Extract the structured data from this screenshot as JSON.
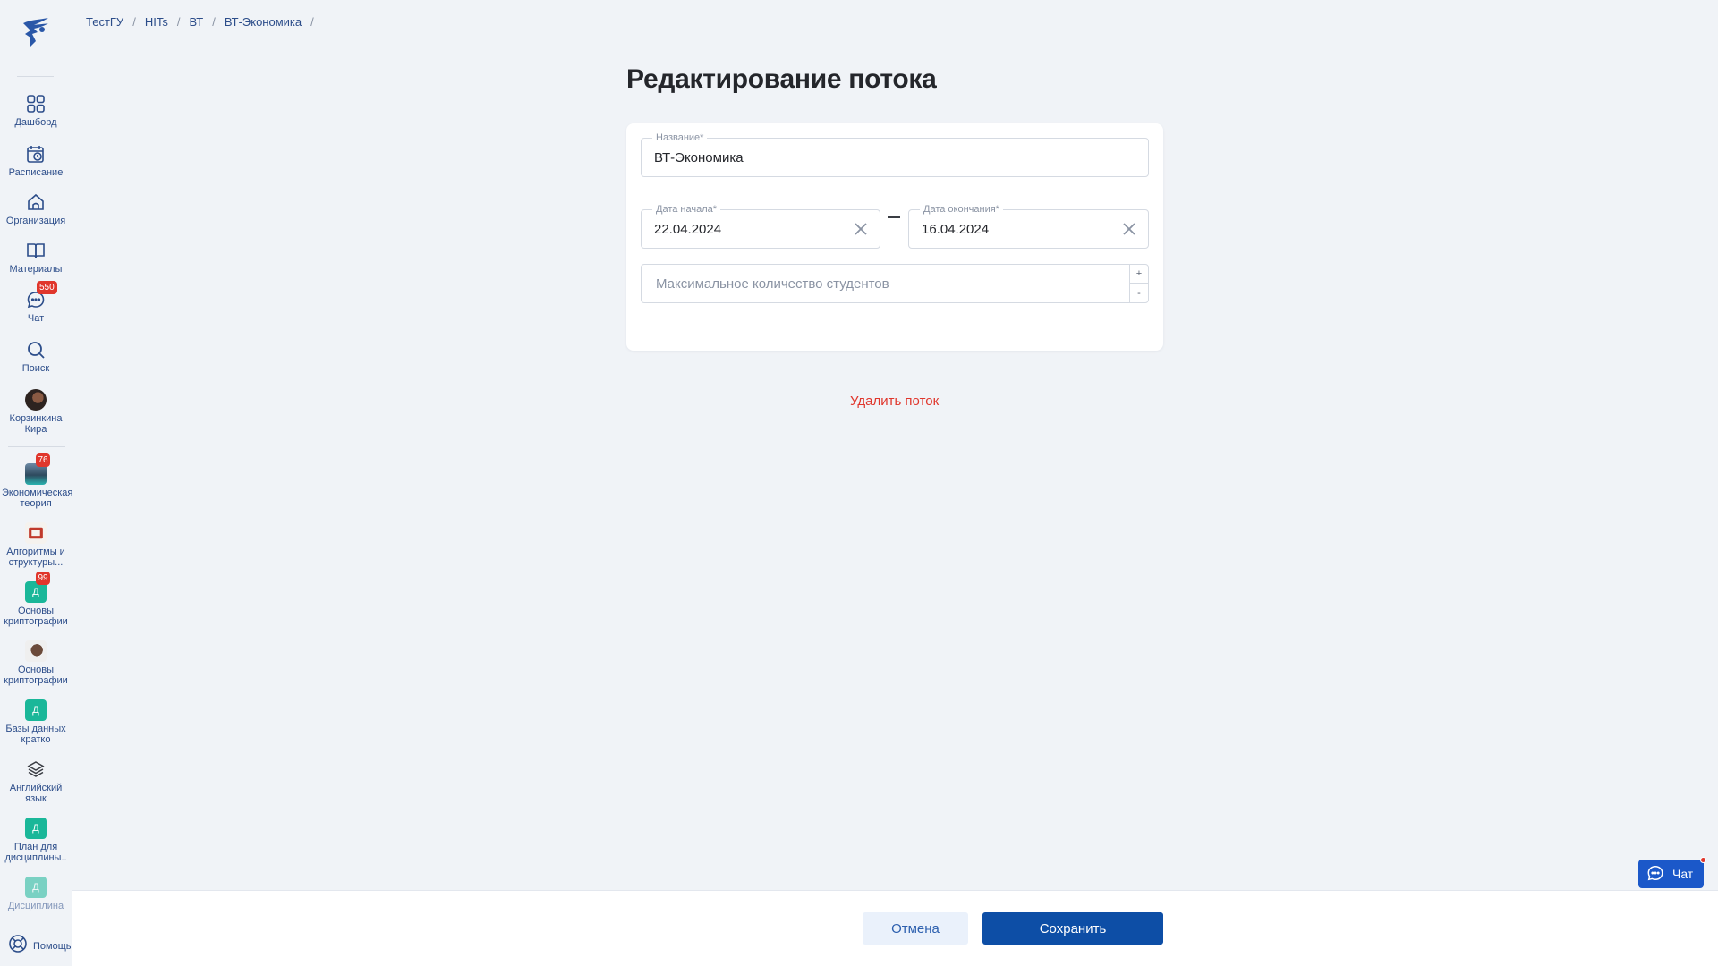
{
  "breadcrumbs": [
    "ТестГУ",
    "HITs",
    "ВТ",
    "ВТ-Экономика"
  ],
  "breadcrumb_separator": "/",
  "sidebar": {
    "nav": [
      {
        "label": "Дашборд",
        "icon": "dashboard-icon"
      },
      {
        "label": "Расписание",
        "icon": "calendar-icon"
      },
      {
        "label": "Организация",
        "icon": "home-icon"
      },
      {
        "label": "Материалы",
        "icon": "book-icon"
      },
      {
        "label": "Чат",
        "icon": "chat-icon",
        "badge": "550"
      },
      {
        "label": "Поиск",
        "icon": "search-icon"
      },
      {
        "label": "Корзинкина Кира",
        "icon": "avatar"
      }
    ],
    "courses": [
      {
        "label": "Экономическая теория",
        "badge": "76",
        "thumb": "image"
      },
      {
        "label": "Алгоритмы и структуры...",
        "thumb": "image"
      },
      {
        "label": "Основы криптографии",
        "badge": "99",
        "thumb": "Д"
      },
      {
        "label": "Основы криптографии",
        "thumb": "image"
      },
      {
        "label": "Базы данных кратко",
        "thumb": "Д"
      },
      {
        "label": "Английский язык",
        "thumb": "layers-icon"
      },
      {
        "label": "План для дисциплины..",
        "thumb": "Д"
      },
      {
        "label": "Дисциплина",
        "thumb": "Д"
      }
    ],
    "help_label": "Помощь"
  },
  "page": {
    "title": "Редактирование потока",
    "form": {
      "name_label": "Название*",
      "name_value": "ВТ-Экономика",
      "start_label": "Дата начала*",
      "start_value": "22.04.2024",
      "end_label": "Дата окончания*",
      "end_value": "16.04.2024",
      "max_students_placeholder": "Максимальное количество студентов",
      "stepper_plus": "+",
      "stepper_minus": "-"
    },
    "delete_label": "Удалить поток"
  },
  "footer": {
    "cancel_label": "Отмена",
    "save_label": "Сохранить"
  },
  "chat_widget": {
    "label": "Чат"
  },
  "colors": {
    "accent": "#0d4ea6",
    "danger": "#e0362c",
    "badge": "#e0362c",
    "course_tile": "#1ab799"
  }
}
